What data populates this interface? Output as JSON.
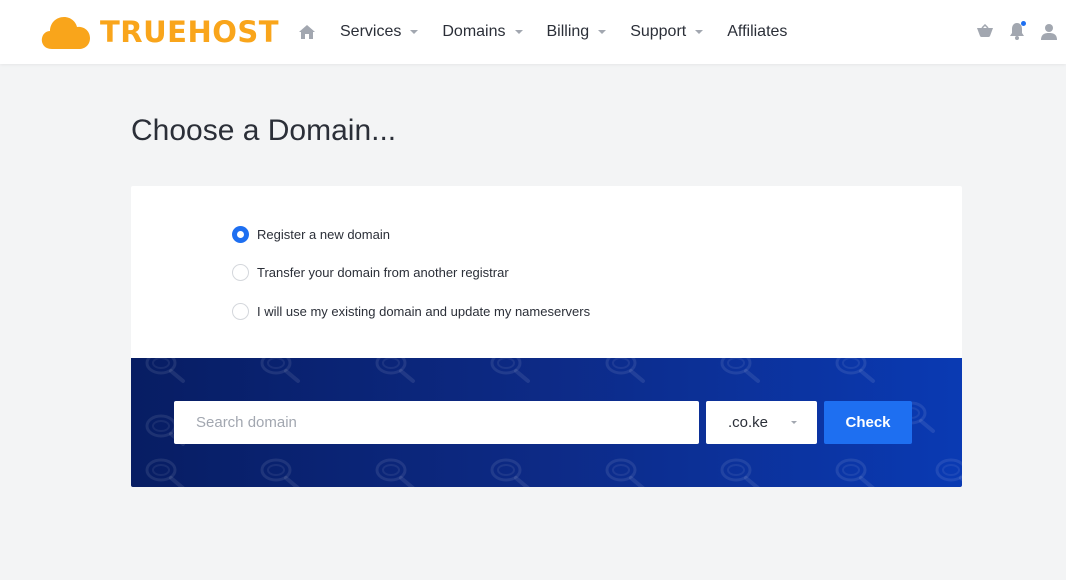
{
  "brand": {
    "name": "TRUEHOST",
    "color": "#f9a51b"
  },
  "nav": {
    "items": [
      {
        "label": "Services",
        "has_dropdown": true
      },
      {
        "label": "Domains",
        "has_dropdown": true
      },
      {
        "label": "Billing",
        "has_dropdown": true
      },
      {
        "label": "Support",
        "has_dropdown": true
      },
      {
        "label": "Affiliates",
        "has_dropdown": false
      }
    ],
    "icons": [
      "home-icon",
      "cart-icon",
      "bell-icon",
      "user-icon"
    ]
  },
  "page": {
    "title": "Choose a Domain..."
  },
  "domain_options": [
    {
      "label": "Register a new domain",
      "checked": true
    },
    {
      "label": "Transfer your domain from another registrar",
      "checked": false
    },
    {
      "label": "I will use my existing domain and update my nameservers",
      "checked": false
    }
  ],
  "search": {
    "placeholder": "Search domain",
    "value": "",
    "tld": ".co.ke",
    "button_label": "Check"
  },
  "colors": {
    "accent": "#1e6ff1",
    "band_dark": "#071d63",
    "band_light": "#0a3ab3",
    "page_bg": "#f3f4f5"
  }
}
